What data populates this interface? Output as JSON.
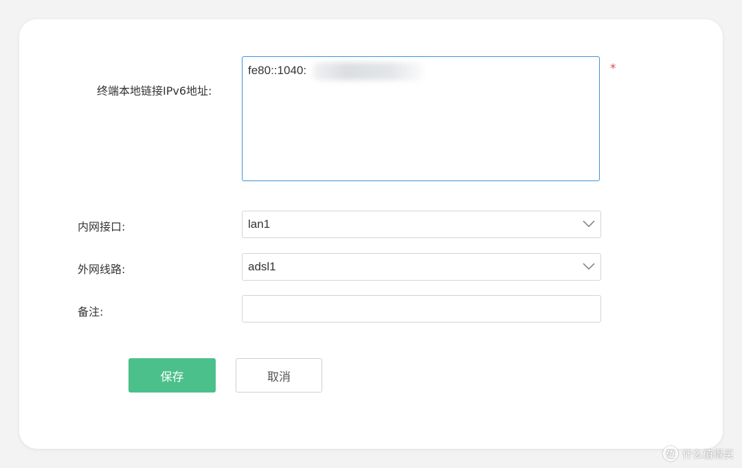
{
  "form": {
    "ipv6": {
      "label": "终端本地链接IPv6地址:",
      "value": "fe80::1040:",
      "required_mark": "*"
    },
    "lan_interface": {
      "label": "内网接口:",
      "value": "lan1"
    },
    "wan_line": {
      "label": "外网线路:",
      "value": "adsl1"
    },
    "remark": {
      "label": "备注:",
      "value": ""
    }
  },
  "buttons": {
    "save_label": "保存",
    "cancel_label": "取消"
  },
  "watermark": {
    "logo_text": "值",
    "text": "什么值得买"
  },
  "colors": {
    "accent_green": "#4cc08a",
    "focus_blue": "#3d8fd8",
    "required_red": "#e64545"
  },
  "icons": {
    "select_arrow": "chevron-down-icon"
  }
}
